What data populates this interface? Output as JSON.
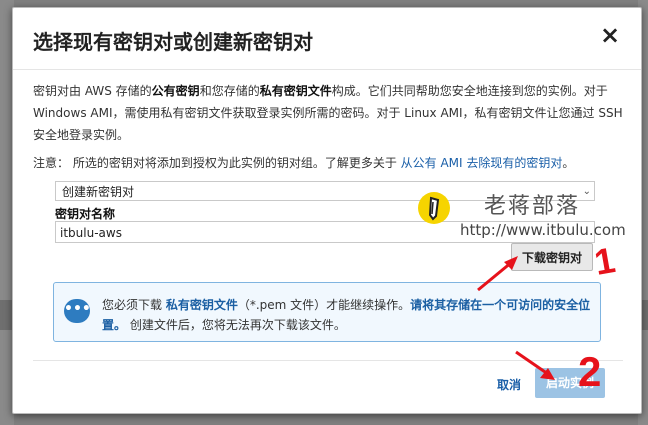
{
  "dialog": {
    "title": "选择现有密钥对或创建新密钥对",
    "close_glyph": "×",
    "desc_a": "密钥对由 AWS 存储的",
    "desc_b": "公有密钥",
    "desc_c": "和您存储的",
    "desc_d": "私有密钥文件",
    "desc_e": "构成。它们共同帮助您安全地连接到您的实例。对于 Windows AMI，需使用私有密钥文件获取登录实例所需的密码。对于 Linux AMI，私有密钥文件让您通过 SSH 安全地登录实例。",
    "note_prefix": "注意： 所选的密钥对将添加到授权为此实例的钥对组。了解更多关于 ",
    "note_link": "从公有 AMI 去除现有的密钥对",
    "note_suffix": "。",
    "select_value": "创建新密钥对",
    "field_label": "密钥对名称",
    "field_value": "itbulu-aws",
    "download_label": "下载密钥对",
    "info_a": "您必须下载 ",
    "info_b": "私有密钥文件",
    "info_c": "（*.pem 文件）才能继续操作。",
    "info_d": "请将其存储在一个可访问的安全位置。",
    "info_e": " 创建文件后，您将无法再次下载该文件。",
    "cancel_label": "取消",
    "launch_label": "启动实例"
  },
  "watermark": {
    "title": "老蒋部落",
    "url": "http://www.itbulu.com"
  },
  "annotations": {
    "one": "1",
    "two": "2"
  },
  "colors": {
    "link": "#1a5fa8",
    "primary_disabled": "#9cc3e4",
    "annotation": "#e6121b",
    "info_border": "#7fb4e0"
  }
}
